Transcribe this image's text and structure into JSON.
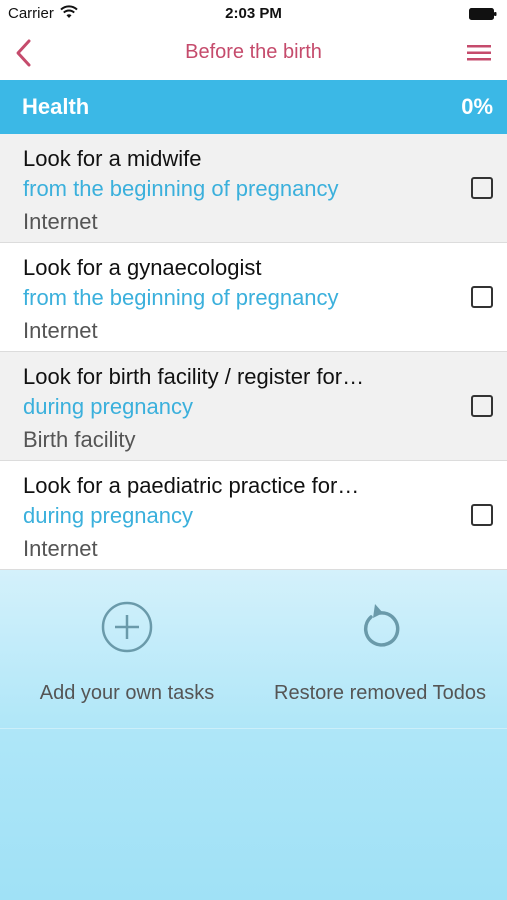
{
  "status_bar": {
    "carrier": "Carrier",
    "time": "2:03 PM"
  },
  "nav": {
    "title": "Before the birth",
    "accent_color": "#c54b6c"
  },
  "section": {
    "name": "Health",
    "progress_label": "0%",
    "progress_value": 0,
    "color": "#3bb8e6"
  },
  "tasks": [
    {
      "title": "Look for a midwife",
      "when": "from the beginning of pregnancy",
      "where": "Internet",
      "checked": false
    },
    {
      "title": "Look for a gynaecologist",
      "when": "from the beginning of pregnancy",
      "where": "Internet",
      "checked": false
    },
    {
      "title": "Look for birth facility / register for…",
      "when": "during pregnancy",
      "where": "Birth facility",
      "checked": false
    },
    {
      "title": "Look for a paediatric practice for…",
      "when": "during pregnancy",
      "where": "Internet",
      "checked": false
    }
  ],
  "actions": {
    "add_label": "Add your own tasks",
    "add_icon": "plus-circle-icon",
    "restore_label": "Restore removed Todos",
    "restore_icon": "restore-icon"
  }
}
